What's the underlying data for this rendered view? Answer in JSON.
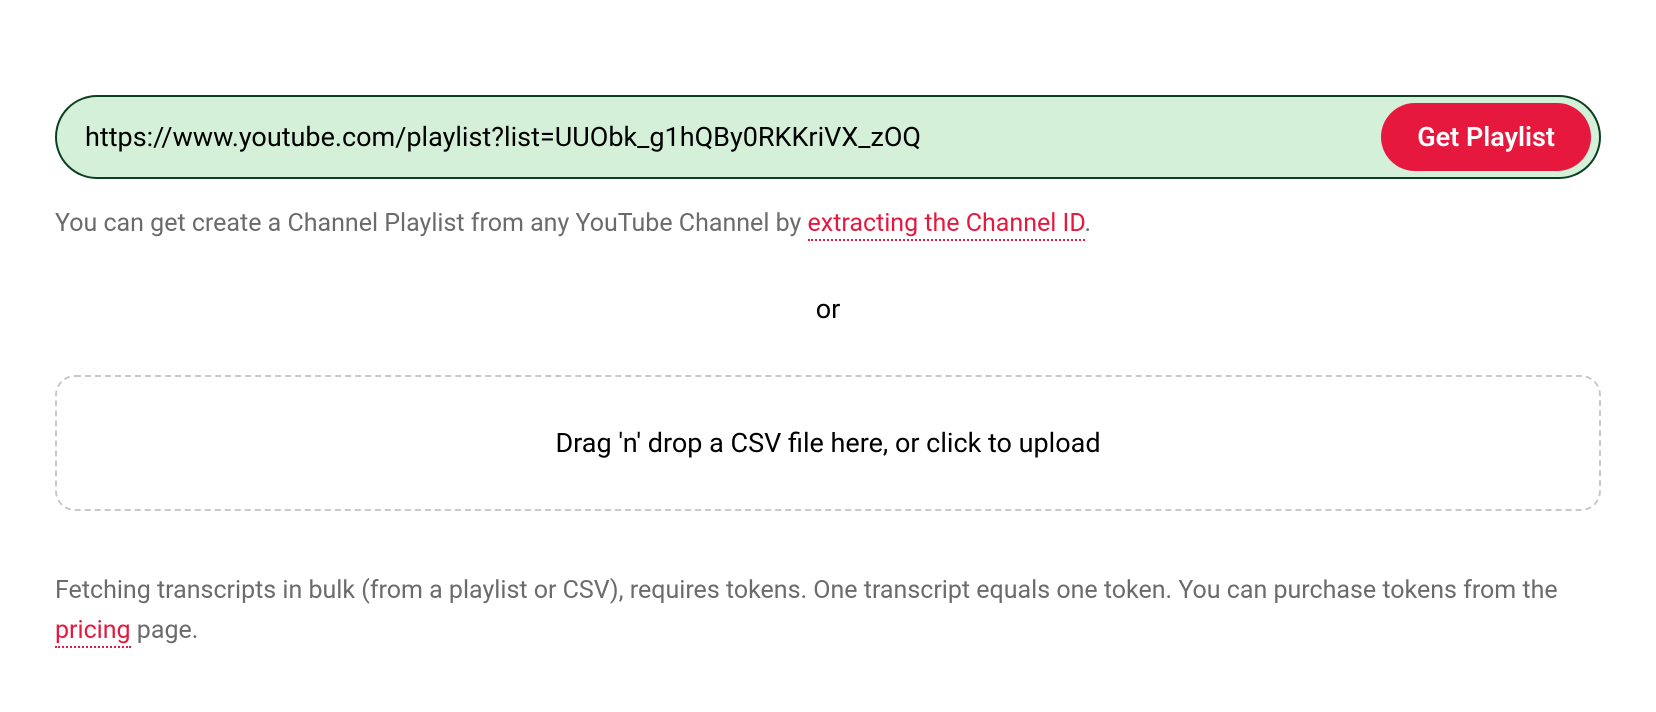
{
  "form": {
    "input_value": "https://www.youtube.com/playlist?list=UUObk_g1hQBy0RKKriVX_zOQ",
    "button_label": "Get Playlist"
  },
  "helper": {
    "prefix": "You can get create a Channel Playlist from any YouTube Channel by ",
    "link_text": "extracting the Channel ID",
    "suffix": "."
  },
  "separator": "or",
  "dropzone": {
    "text": "Drag 'n' drop a CSV file here, or click to upload"
  },
  "footer": {
    "prefix": "Fetching transcripts in bulk (from a playlist or CSV), requires tokens. One transcript equals one token. You can purchase tokens from the ",
    "link_text": "pricing",
    "suffix": " page."
  }
}
